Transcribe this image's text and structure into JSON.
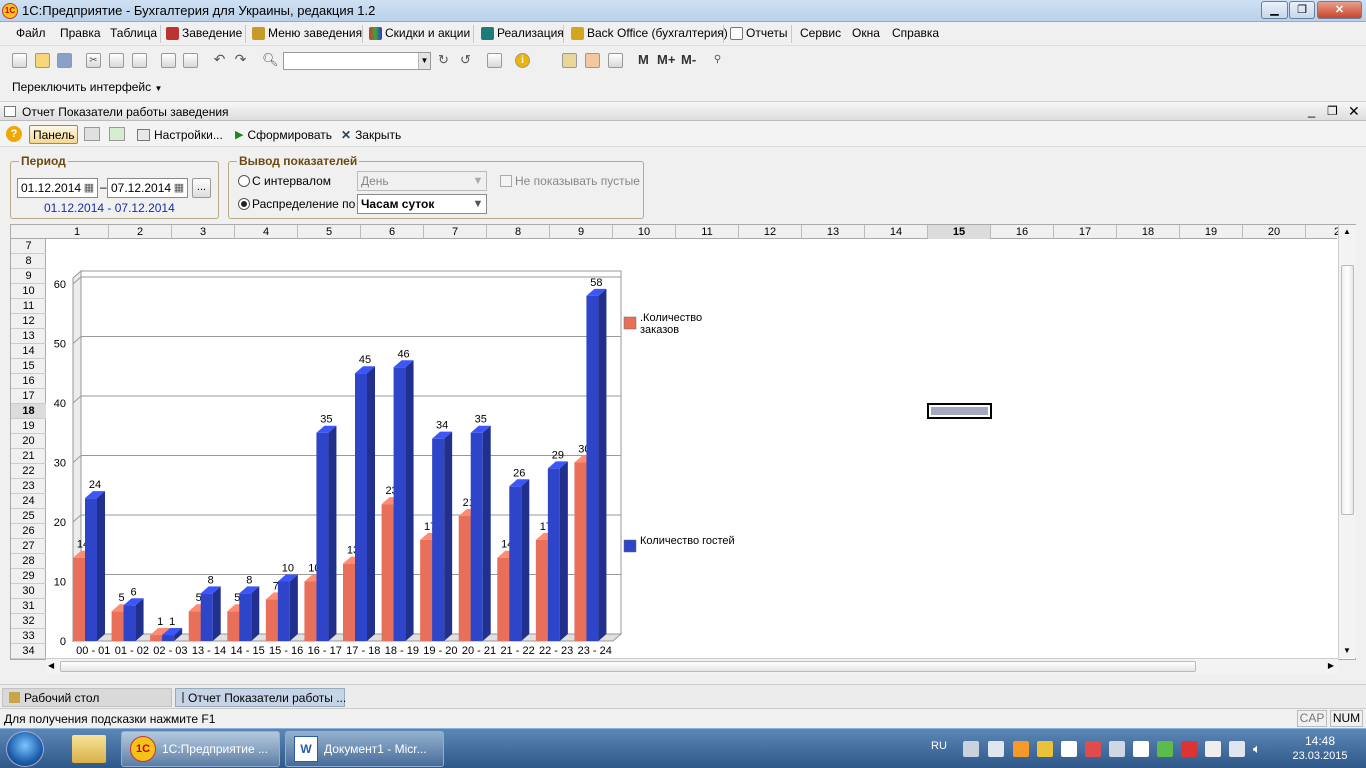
{
  "window": {
    "title": "1С:Предприятие - Бухгалтерия для Украины, редакция 1.2",
    "app_logo": "1C"
  },
  "menu": [
    {
      "label": "Файл",
      "icon": ""
    },
    {
      "label": "Правка",
      "icon": ""
    },
    {
      "label": "Таблица",
      "icon": ""
    },
    {
      "label": "Заведение",
      "icon": "building-icon"
    },
    {
      "label": "Меню заведения",
      "icon": "menu-book-icon"
    },
    {
      "label": "Скидки и акции",
      "icon": "tag-icon"
    },
    {
      "label": "Реализация",
      "icon": "register-icon"
    },
    {
      "label": "Back Office (бухгалтерия)",
      "icon": "ledger-icon"
    },
    {
      "label": "Отчеты",
      "icon": "report-icon"
    },
    {
      "label": "Сервис",
      "icon": ""
    },
    {
      "label": "Окна",
      "icon": ""
    },
    {
      "label": "Справка",
      "icon": ""
    }
  ],
  "toolbar": {
    "search_value": "",
    "memory_buttons": [
      "M",
      "M+",
      "M-"
    ],
    "interface_switch": "Переключить интерфейс"
  },
  "document": {
    "title": "Отчет  Показатели работы заведения",
    "buttons": {
      "help": "?",
      "panel": "Панель",
      "settings": "Настройки...",
      "generate": "Сформировать",
      "close": "Закрыть"
    }
  },
  "period": {
    "label": "Период",
    "from": "01.12.2014",
    "to": "07.12.2014",
    "dash": "–",
    "summary": "01.12.2014 - 07.12.2014",
    "more_button": "..."
  },
  "output": {
    "label": "Вывод показателей",
    "interval_radio": "С интервалом",
    "interval_value": "День",
    "distribution_radio": "Распределение по",
    "distribution_value": "Часам суток",
    "selected": "distribution",
    "hide_empty_label": "Не показывать пустые",
    "hide_empty_checked": false
  },
  "sheet": {
    "columns": [
      "1",
      "2",
      "3",
      "4",
      "5",
      "6",
      "7",
      "8",
      "9",
      "10",
      "11",
      "12",
      "13",
      "14",
      "15",
      "16",
      "17",
      "18",
      "19",
      "20",
      "2"
    ],
    "active_column": "15",
    "rows": [
      "7",
      "8",
      "9",
      "10",
      "11",
      "12",
      "13",
      "14",
      "15",
      "16",
      "17",
      "18",
      "19",
      "20",
      "21",
      "22",
      "23",
      "24",
      "25",
      "26",
      "27",
      "28",
      "29",
      "30",
      "31",
      "32",
      "33",
      "34"
    ],
    "active_row": "18"
  },
  "chart_data": {
    "type": "bar",
    "categories": [
      "00 - 01",
      "01 - 02",
      "02 - 03",
      "13 - 14",
      "14 - 15",
      "15 - 16",
      "16 - 17",
      "17 - 18",
      "18 - 19",
      "19 - 20",
      "20 - 21",
      "21 - 22",
      "22 - 23",
      "23 - 24"
    ],
    "series": [
      {
        "name": ".Количество заказов",
        "color": "#e8705a",
        "values": [
          14,
          5,
          1,
          5,
          5,
          7,
          10,
          13,
          23,
          17,
          21,
          14,
          17,
          30
        ]
      },
      {
        "name": "Количество гостей",
        "color": "#2f45c9",
        "values": [
          24,
          6,
          1,
          8,
          8,
          10,
          35,
          45,
          46,
          34,
          35,
          26,
          29,
          58
        ]
      }
    ],
    "yticks": [
      0,
      10,
      20,
      30,
      40,
      50,
      60
    ],
    "ylim": [
      0,
      61
    ],
    "grid": true,
    "legend": "right"
  },
  "bottom_tabs": [
    "Рабочий стол",
    "Отчет  Показатели работы ..."
  ],
  "status": {
    "hint": "Для получения подсказки нажмите F1",
    "cap": "CAP",
    "num": "NUM"
  },
  "taskbar": {
    "apps": [
      "1С:Предприятие ...",
      "Документ1 - Micr..."
    ],
    "lang": "RU",
    "time": "14:48",
    "date": "23.03.2015"
  }
}
